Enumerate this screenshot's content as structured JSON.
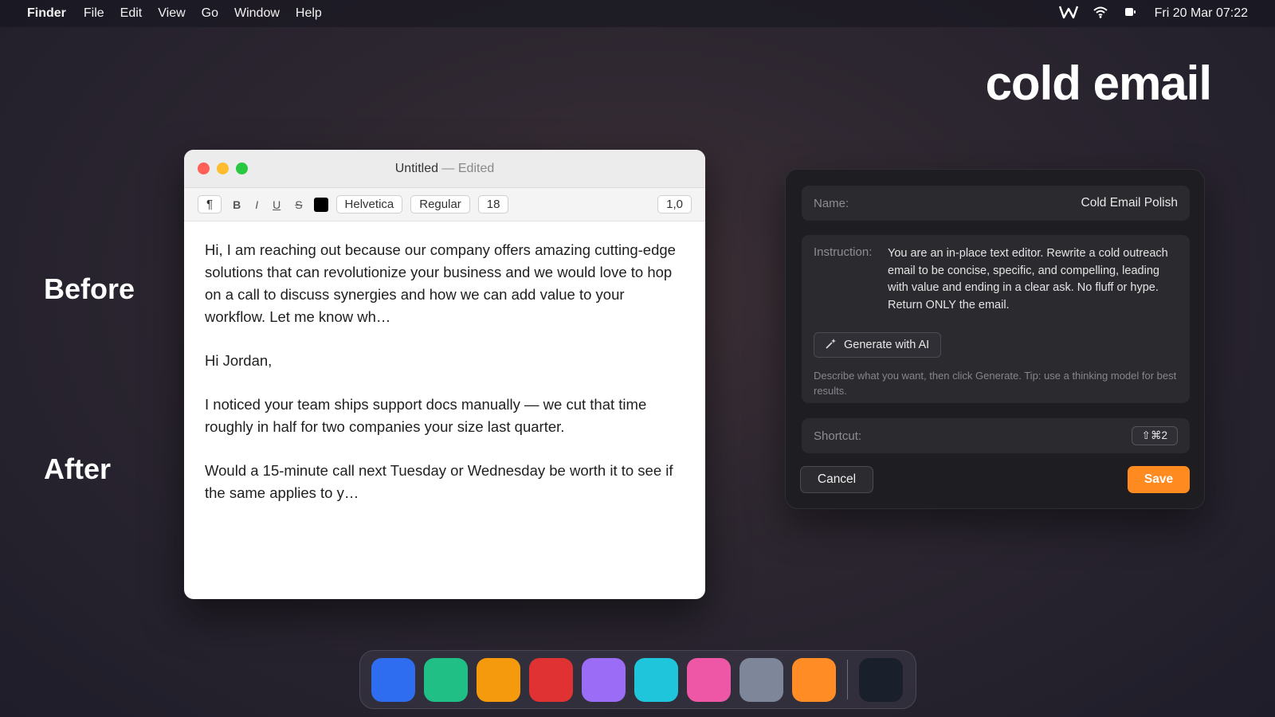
{
  "menubar": {
    "app": "Finder",
    "items": [
      "File",
      "Edit",
      "View",
      "Go",
      "Window",
      "Help"
    ],
    "clock": "Fri 20 Mar  07:22"
  },
  "headline": "cold email",
  "labels": {
    "before": "Before",
    "after": "After"
  },
  "editor": {
    "title": "Untitled",
    "title_suffix": " — Edited",
    "toolbar": {
      "paragraph": "¶",
      "bold": "B",
      "italic": "I",
      "underline": "U",
      "strike": "S",
      "font": "Helvetica",
      "style": "Regular",
      "size": "18",
      "spacing": "1,0"
    },
    "paragraphs": [
      "Hi, I am reaching out because our company offers amazing cutting-edge solutions that can revolutionize your business and we would love to hop on a call to discuss synergies and how we can add value to your workflow. Let me know wh…",
      "Hi Jordan,",
      "I noticed your team ships support docs manually — we cut that time roughly in half for two companies your size last quarter.",
      "Would a 15-minute call next Tuesday or Wednesday be worth it to see if the same applies to y…"
    ]
  },
  "panel": {
    "name_label": "Name:",
    "name_value": "Cold Email Polish",
    "instruction_label": "Instruction:",
    "instruction_text": "You are an in-place text editor. Rewrite a cold outreach email to be concise, specific, and compelling, leading with value and ending in a clear ask. No fluff or hype. Return ONLY the email.",
    "generate_label": "Generate with AI",
    "hint": "Describe what you want, then click Generate. Tip: use a thinking model for best results.",
    "shortcut_label": "Shortcut:",
    "shortcut_value": "⇧⌘2",
    "cancel_label": "Cancel",
    "save_label": "Save"
  },
  "dock": {
    "icons": [
      "#2f6df0",
      "#20bf85",
      "#f59a0c",
      "#e03232",
      "#9b6cf5",
      "#1fc5db",
      "#ee57a6",
      "#7e8799",
      "#ff8c25"
    ],
    "last_icon": "#1a1f2c"
  },
  "colors": {
    "accent": "#ff8a1f"
  }
}
